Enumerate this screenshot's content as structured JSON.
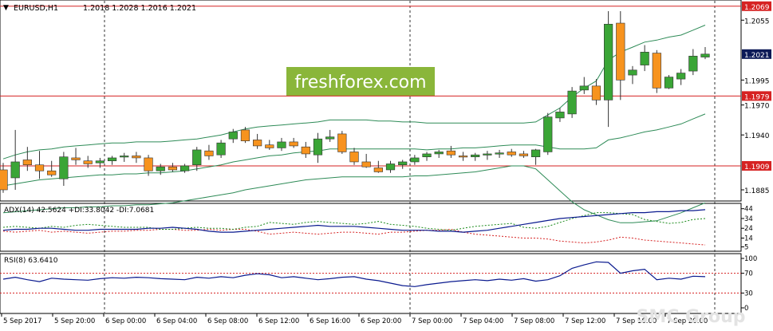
{
  "header": {
    "symbol": "EURUSD,H1",
    "ohlc": "1.2018 1.2028 1.2016 1.2021",
    "watermark": "freshforex.com",
    "corner_watermark": "SMC Group"
  },
  "colors": {
    "bull": "#3aa536",
    "bear": "#f7931e",
    "band": "#2e8b57",
    "level": "#d62222",
    "price_tag": "#0c1a57",
    "adx": "#0a1a8f",
    "di_plus": "#1a8a1a",
    "di_minus": "#d62222",
    "rsi": "#0a1a8f",
    "watermark_bg": "#8ab63a"
  },
  "price_axis": {
    "ticks": [
      "1.2055",
      "1.1995",
      "1.1970",
      "1.1940",
      "1.1885"
    ],
    "levels": [
      {
        "value": 1.2069,
        "label": "1.2069"
      },
      {
        "value": 1.1979,
        "label": "1.1979"
      },
      {
        "value": 1.1909,
        "label": "1.1909"
      }
    ],
    "current": {
      "value": 1.2021,
      "label": "1.2021"
    },
    "range": [
      1.1877,
      1.2072
    ]
  },
  "time_axis": {
    "labels": [
      "5 Sep 2017",
      "5 Sep 20:00",
      "6 Sep 00:00",
      "6 Sep 04:00",
      "6 Sep 08:00",
      "6 Sep 12:00",
      "6 Sep 16:00",
      "6 Sep 20:00",
      "7 Sep 00:00",
      "7 Sep 04:00",
      "7 Sep 08:00",
      "7 Sep 12:00",
      "7 Sep 16:00",
      "7 Sep 20:00"
    ]
  },
  "adx_panel": {
    "label": "ADX(14) 42.5624 +DI:33.8042 -DI:7.0681",
    "ticks": [
      "44",
      "34",
      "24",
      "14",
      "5"
    ],
    "range": [
      3,
      47
    ],
    "adx": [
      22,
      23,
      23,
      24,
      24,
      23,
      22,
      22,
      23,
      23,
      23,
      23,
      24,
      24,
      25,
      24,
      23,
      21,
      20,
      20,
      21,
      22,
      23,
      24,
      25,
      26,
      27,
      26,
      26,
      26,
      25,
      24,
      23,
      22,
      22,
      22,
      21,
      21,
      20,
      21,
      22,
      24,
      26,
      28,
      30,
      32,
      34,
      35,
      36,
      37,
      38,
      39,
      40,
      40,
      41,
      41,
      42,
      42,
      43
    ],
    "di_plus": [
      25,
      26,
      25,
      24,
      26,
      25,
      27,
      28,
      27,
      26,
      25,
      25,
      25,
      23,
      23,
      24,
      25,
      24,
      24,
      23,
      25,
      26,
      30,
      29,
      28,
      30,
      31,
      30,
      29,
      28,
      29,
      31,
      28,
      27,
      26,
      24,
      23,
      22,
      24,
      26,
      27,
      28,
      29,
      25,
      24,
      26,
      30,
      34,
      37,
      40,
      40,
      39,
      38,
      33,
      31,
      29,
      30,
      33,
      34
    ],
    "di_minus": [
      21,
      20,
      21,
      22,
      20,
      21,
      20,
      19,
      20,
      21,
      21,
      22,
      22,
      23,
      23,
      22,
      22,
      23,
      22,
      23,
      23,
      21,
      18,
      19,
      20,
      19,
      18,
      19,
      20,
      20,
      19,
      18,
      20,
      20,
      21,
      22,
      22,
      23,
      20,
      18,
      17,
      16,
      15,
      14,
      14,
      13,
      11,
      10,
      9,
      10,
      12,
      15,
      14,
      12,
      11,
      10,
      9,
      8,
      7
    ]
  },
  "rsi_panel": {
    "label": "RSI(8) 63.6410",
    "ticks": [
      "100",
      "70",
      "30",
      "0"
    ],
    "range": [
      0,
      100
    ],
    "levels": [
      70,
      30
    ],
    "values": [
      58,
      62,
      57,
      53,
      60,
      58,
      57,
      56,
      59,
      61,
      60,
      62,
      61,
      59,
      58,
      57,
      62,
      60,
      63,
      61,
      66,
      69,
      67,
      61,
      63,
      60,
      57,
      59,
      62,
      63,
      58,
      55,
      50,
      45,
      43,
      47,
      50,
      53,
      55,
      57,
      55,
      58,
      56,
      59,
      54,
      57,
      65,
      80,
      87,
      93,
      92,
      70,
      75,
      78,
      57,
      60,
      58,
      64,
      63
    ]
  },
  "chart_data": {
    "type": "candlestick",
    "title": "EURUSD,H1",
    "ylim": [
      1.1877,
      1.2072
    ],
    "candles": [
      {
        "o": 1.1905,
        "h": 1.1912,
        "l": 1.1882,
        "c": 1.1885
      },
      {
        "o": 1.1897,
        "h": 1.1945,
        "l": 1.1885,
        "c": 1.1913
      },
      {
        "o": 1.1915,
        "h": 1.1928,
        "l": 1.1904,
        "c": 1.191
      },
      {
        "o": 1.191,
        "h": 1.1924,
        "l": 1.1896,
        "c": 1.1904
      },
      {
        "o": 1.1904,
        "h": 1.1914,
        "l": 1.1898,
        "c": 1.19
      },
      {
        "o": 1.1896,
        "h": 1.1923,
        "l": 1.1889,
        "c": 1.1918
      },
      {
        "o": 1.1917,
        "h": 1.1927,
        "l": 1.191,
        "c": 1.1915
      },
      {
        "o": 1.1914,
        "h": 1.1919,
        "l": 1.1907,
        "c": 1.1911
      },
      {
        "o": 1.1912,
        "h": 1.1917,
        "l": 1.1907,
        "c": 1.1914
      },
      {
        "o": 1.1914,
        "h": 1.1919,
        "l": 1.191,
        "c": 1.1917
      },
      {
        "o": 1.1918,
        "h": 1.1922,
        "l": 1.1913,
        "c": 1.1919
      },
      {
        "o": 1.1919,
        "h": 1.1923,
        "l": 1.1912,
        "c": 1.1917
      },
      {
        "o": 1.1917,
        "h": 1.192,
        "l": 1.1899,
        "c": 1.1904
      },
      {
        "o": 1.1904,
        "h": 1.1911,
        "l": 1.19,
        "c": 1.1908
      },
      {
        "o": 1.1908,
        "h": 1.1912,
        "l": 1.1903,
        "c": 1.1905
      },
      {
        "o": 1.1904,
        "h": 1.1911,
        "l": 1.1902,
        "c": 1.1909
      },
      {
        "o": 1.191,
        "h": 1.1928,
        "l": 1.1904,
        "c": 1.1925
      },
      {
        "o": 1.1924,
        "h": 1.193,
        "l": 1.1915,
        "c": 1.1919
      },
      {
        "o": 1.192,
        "h": 1.1935,
        "l": 1.1917,
        "c": 1.1932
      },
      {
        "o": 1.1936,
        "h": 1.1946,
        "l": 1.1932,
        "c": 1.1943
      },
      {
        "o": 1.1945,
        "h": 1.1948,
        "l": 1.1932,
        "c": 1.1934
      },
      {
        "o": 1.1935,
        "h": 1.1941,
        "l": 1.1926,
        "c": 1.1929
      },
      {
        "o": 1.193,
        "h": 1.1935,
        "l": 1.1925,
        "c": 1.1927
      },
      {
        "o": 1.1927,
        "h": 1.1937,
        "l": 1.1924,
        "c": 1.1933
      },
      {
        "o": 1.1933,
        "h": 1.1937,
        "l": 1.1927,
        "c": 1.1929
      },
      {
        "o": 1.1928,
        "h": 1.1933,
        "l": 1.1917,
        "c": 1.1921
      },
      {
        "o": 1.192,
        "h": 1.1942,
        "l": 1.1912,
        "c": 1.1936
      },
      {
        "o": 1.1936,
        "h": 1.1945,
        "l": 1.1933,
        "c": 1.1938
      },
      {
        "o": 1.1941,
        "h": 1.1944,
        "l": 1.1921,
        "c": 1.1923
      },
      {
        "o": 1.1923,
        "h": 1.1927,
        "l": 1.191,
        "c": 1.1913
      },
      {
        "o": 1.1913,
        "h": 1.1921,
        "l": 1.1907,
        "c": 1.1908
      },
      {
        "o": 1.1907,
        "h": 1.1914,
        "l": 1.1902,
        "c": 1.1903
      },
      {
        "o": 1.1905,
        "h": 1.1914,
        "l": 1.1902,
        "c": 1.1911
      },
      {
        "o": 1.191,
        "h": 1.1915,
        "l": 1.1906,
        "c": 1.1913
      },
      {
        "o": 1.1913,
        "h": 1.192,
        "l": 1.191,
        "c": 1.1917
      },
      {
        "o": 1.1918,
        "h": 1.1923,
        "l": 1.1914,
        "c": 1.1921
      },
      {
        "o": 1.1921,
        "h": 1.1925,
        "l": 1.1917,
        "c": 1.1923
      },
      {
        "o": 1.1924,
        "h": 1.1929,
        "l": 1.1917,
        "c": 1.192
      },
      {
        "o": 1.1919,
        "h": 1.1923,
        "l": 1.1914,
        "c": 1.1918
      },
      {
        "o": 1.1918,
        "h": 1.1922,
        "l": 1.1914,
        "c": 1.192
      },
      {
        "o": 1.192,
        "h": 1.1924,
        "l": 1.1915,
        "c": 1.1921
      },
      {
        "o": 1.1922,
        "h": 1.1925,
        "l": 1.1917,
        "c": 1.1922
      },
      {
        "o": 1.1923,
        "h": 1.1926,
        "l": 1.1918,
        "c": 1.192
      },
      {
        "o": 1.1921,
        "h": 1.1924,
        "l": 1.1917,
        "c": 1.1919
      },
      {
        "o": 1.1918,
        "h": 1.1926,
        "l": 1.191,
        "c": 1.1925
      },
      {
        "o": 1.1923,
        "h": 1.1962,
        "l": 1.192,
        "c": 1.1958
      },
      {
        "o": 1.1957,
        "h": 1.1967,
        "l": 1.1953,
        "c": 1.1963
      },
      {
        "o": 1.1961,
        "h": 1.1988,
        "l": 1.1957,
        "c": 1.1984
      },
      {
        "o": 1.1985,
        "h": 1.1998,
        "l": 1.1981,
        "c": 1.1989
      },
      {
        "o": 1.1989,
        "h": 1.1996,
        "l": 1.197,
        "c": 1.1975
      },
      {
        "o": 1.1975,
        "h": 1.2064,
        "l": 1.1948,
        "c": 1.2051
      },
      {
        "o": 1.2052,
        "h": 1.2064,
        "l": 1.1975,
        "c": 1.1995
      },
      {
        "o": 1.2,
        "h": 1.2009,
        "l": 1.1991,
        "c": 1.2005
      },
      {
        "o": 1.201,
        "h": 1.203,
        "l": 1.2004,
        "c": 1.2023
      },
      {
        "o": 1.2022,
        "h": 1.2025,
        "l": 1.1982,
        "c": 1.1987
      },
      {
        "o": 1.1987,
        "h": 1.2,
        "l": 1.1986,
        "c": 1.1998
      },
      {
        "o": 1.1996,
        "h": 1.2006,
        "l": 1.199,
        "c": 1.2002
      },
      {
        "o": 1.2004,
        "h": 1.2026,
        "l": 1.2,
        "c": 1.2019
      },
      {
        "o": 1.2018,
        "h": 1.2028,
        "l": 1.2016,
        "c": 1.2021
      }
    ],
    "bollinger_upper": [
      1.1916,
      1.192,
      1.1923,
      1.1925,
      1.1926,
      1.1928,
      1.1929,
      1.193,
      1.1931,
      1.1932,
      1.1932,
      1.1933,
      1.1933,
      1.1933,
      1.1934,
      1.1935,
      1.1936,
      1.1938,
      1.194,
      1.1943,
      1.1946,
      1.1948,
      1.1949,
      1.195,
      1.1951,
      1.1952,
      1.1953,
      1.1955,
      1.1955,
      1.1955,
      1.1955,
      1.1954,
      1.1954,
      1.1953,
      1.1953,
      1.1952,
      1.1952,
      1.1952,
      1.1952,
      1.1952,
      1.1952,
      1.1952,
      1.1952,
      1.1952,
      1.1953,
      1.196,
      1.1967,
      1.1978,
      1.1987,
      1.1994,
      1.2015,
      1.2023,
      1.2028,
      1.2033,
      1.2035,
      1.2038,
      1.204,
      1.2045,
      1.205
    ],
    "bollinger_lower": [
      1.1862,
      1.1863,
      1.1864,
      1.1865,
      1.1866,
      1.1867,
      1.1867,
      1.1868,
      1.1868,
      1.1869,
      1.1869,
      1.187,
      1.187,
      1.1871,
      1.1872,
      1.1874,
      1.1876,
      1.1878,
      1.188,
      1.1882,
      1.1885,
      1.1887,
      1.1889,
      1.1891,
      1.1893,
      1.1895,
      1.1896,
      1.1897,
      1.1898,
      1.1898,
      1.1898,
      1.1898,
      1.1898,
      1.1898,
      1.1899,
      1.1899,
      1.19,
      1.1901,
      1.1902,
      1.1903,
      1.1905,
      1.1907,
      1.1909,
      1.1909,
      1.1906,
      1.1895,
      1.1884,
      1.1873,
      1.1865,
      1.186,
      1.1855,
      1.1852,
      1.1852,
      1.1853,
      1.1854,
      1.1858,
      1.1862,
      1.1867,
      1.1872
    ],
    "bollinger_mid": [
      1.1889,
      1.1891,
      1.1893,
      1.1895,
      1.1896,
      1.1897,
      1.1898,
      1.1899,
      1.19,
      1.19,
      1.1901,
      1.1901,
      1.1902,
      1.1902,
      1.1903,
      1.1904,
      1.1906,
      1.1908,
      1.191,
      1.1913,
      1.1915,
      1.1917,
      1.1919,
      1.192,
      1.1922,
      1.1923,
      1.1924,
      1.1926,
      1.1926,
      1.1926,
      1.1926,
      1.1926,
      1.1926,
      1.1926,
      1.1926,
      1.1925,
      1.1926,
      1.1926,
      1.1927,
      1.1927,
      1.1928,
      1.1929,
      1.193,
      1.193,
      1.193,
      1.1928,
      1.1926,
      1.1926,
      1.1926,
      1.1927,
      1.1935,
      1.1937,
      1.194,
      1.1943,
      1.1945,
      1.1948,
      1.1951,
      1.1956,
      1.1961
    ]
  }
}
